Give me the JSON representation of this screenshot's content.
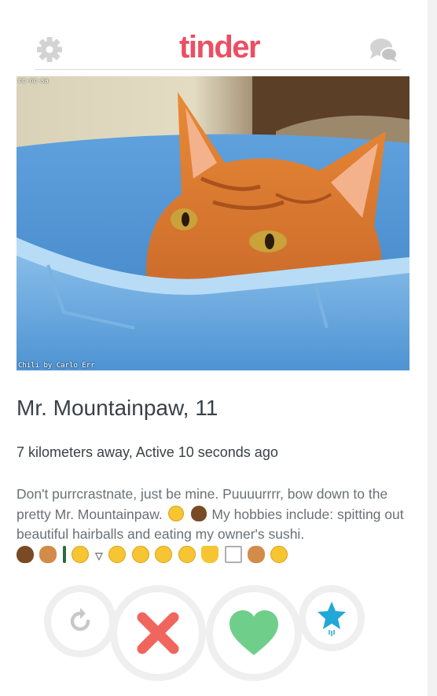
{
  "app": {
    "logo_text": "tinder",
    "brand_color": "#ec4e62"
  },
  "header": {
    "settings_icon": "gear-icon",
    "messages_icon": "chat-bubbles-icon"
  },
  "photo": {
    "license_text": "cc-nc-sa",
    "credit_text": "Chili by Carlo Err"
  },
  "profile": {
    "name_age": "Mr. Mountainpaw, 11",
    "distance_activity": "7 kilometers away, Active 10 seconds ago",
    "bio_part1": "Don't purrcrastnate, just be mine. Puuuurrrr, bow down to the pretty Mr. Mountainpaw.",
    "bio_part2": "My hobbies include: spitting out beautiful hairballs and eating my owner's sushi."
  },
  "actions": {
    "rewind_icon": "rewind-icon",
    "nope_icon": "x-icon",
    "like_icon": "heart-icon",
    "superlike_icon": "star-icon",
    "nope_color": "#f0655e",
    "like_color": "#6fcf8a",
    "superlike_color": "#20a8d8"
  }
}
